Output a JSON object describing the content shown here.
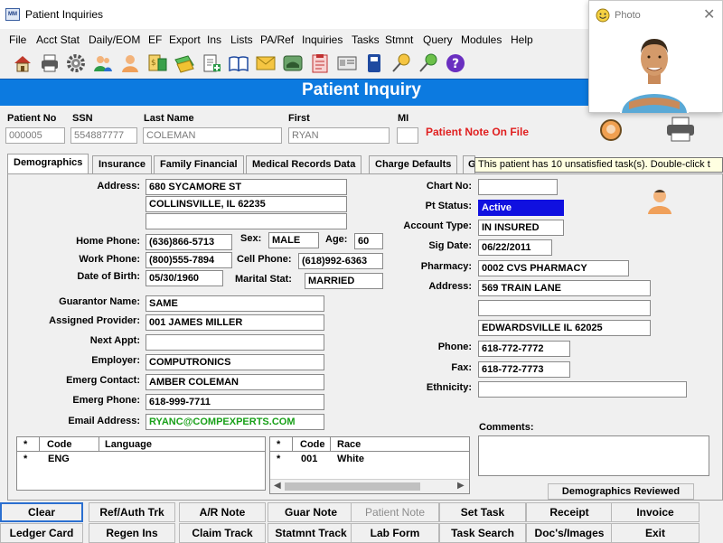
{
  "window": {
    "title": "Patient Inquiries"
  },
  "menu": [
    "File",
    "Acct Stat",
    "Daily/EOM",
    "EF",
    "Export",
    "Ins",
    "Lists",
    "PA/Ref",
    "Inquiries",
    "Tasks",
    "Stmnt",
    "Query",
    "Modules",
    "Help"
  ],
  "toolbar_icons": [
    "home-icon",
    "printer-icon",
    "gear-icon",
    "users-icon",
    "person-icon",
    "calculator-icon",
    "money-icon",
    "document-plus-icon",
    "book-icon",
    "envelope-icon",
    "car-icon",
    "clipboard-icon",
    "id-card-icon",
    "binder-icon",
    "pushpin-icon",
    "pushpin-alt-icon",
    "help-icon"
  ],
  "header": {
    "title": "Patient Inquiry"
  },
  "photo_window": {
    "title": "Photo"
  },
  "patient": {
    "labels": {
      "no": "Patient No",
      "ssn": "SSN",
      "last": "Last Name",
      "first": "First",
      "mi": "MI"
    },
    "no": "000005",
    "ssn": "554887777",
    "last": "COLEMAN",
    "first": "RYAN",
    "mi": "",
    "note_alert": "Patient Note On File"
  },
  "tabs": [
    "Demographics",
    "Insurance",
    "Family Financial",
    "Medical Records Data",
    "Charge Defaults",
    "G"
  ],
  "tooltip": "This patient has 10 unsatisfied task(s). Double-click t",
  "demo": {
    "labels": {
      "address": "Address:",
      "home_phone": "Home Phone:",
      "sex": "Sex:",
      "age": "Age:",
      "work_phone": "Work Phone:",
      "cell_phone": "Cell Phone:",
      "dob": "Date of Birth:",
      "marital": "Marital Stat:",
      "guarantor": "Guarantor Name:",
      "provider": "Assigned Provider:",
      "next_appt": "Next Appt:",
      "employer": "Employer:",
      "emerg_contact": "Emerg Contact:",
      "emerg_phone": "Emerg Phone:",
      "email": "Email Address:"
    },
    "address1": "680 SYCAMORE ST",
    "address2": "COLLINSVILLE, IL 62235",
    "address3": "",
    "home_phone": "(636)866-5713",
    "sex": "MALE",
    "age": "60",
    "work_phone": "(800)555-7894",
    "cell_phone": "(618)992-6363",
    "dob": "05/30/1960",
    "marital": "MARRIED",
    "guarantor": "SAME",
    "provider": "001 JAMES  MILLER",
    "next_appt": "",
    "employer": "COMPUTRONICS",
    "emerg_contact": "AMBER COLEMAN",
    "emerg_phone": "618-999-7711",
    "email": "RYANC@COMPEXPERTS.COM"
  },
  "right": {
    "labels": {
      "chart_no": "Chart No:",
      "pt_status": "Pt Status:",
      "account_type": "Account Type:",
      "sig_date": "Sig Date:",
      "pharmacy": "Pharmacy:",
      "address": "Address:",
      "phone": "Phone:",
      "fax": "Fax:",
      "ethnicity": "Ethnicity:",
      "comments": "Comments:"
    },
    "chart_no": "",
    "pt_status": "Active",
    "account_type": "IN INSURED",
    "sig_date": "06/22/2011",
    "pharmacy": "0002 CVS PHARMACY",
    "pharm_address1": "569 TRAIN LANE",
    "pharm_address2": "",
    "pharm_address3": "EDWARDSVILLE IL 62025",
    "phone": "618-772-7772",
    "fax": "618-772-7773",
    "ethnicity": "",
    "comments": ""
  },
  "language_grid": {
    "headers": [
      "*",
      "Code",
      "Language"
    ],
    "rows": [
      [
        "*",
        "ENG",
        ""
      ]
    ]
  },
  "race_grid": {
    "headers": [
      "*",
      "Code",
      "Race"
    ],
    "rows": [
      [
        "*",
        "001",
        "White"
      ]
    ]
  },
  "demographics_reviewed": "Demographics Reviewed",
  "buttons_row1": [
    "Clear",
    "Ref/Auth Trk",
    "A/R Note",
    "Guar Note",
    "Patient Note",
    "Set Task",
    "Receipt",
    "Invoice"
  ],
  "buttons_row2": [
    "Ledger Card",
    "Regen Ins",
    "Claim Track",
    "Statmnt Track",
    "Lab Form",
    "Task Search",
    "Doc's/Images",
    "Exit"
  ],
  "colors": {
    "header_blue": "#0c7ae0",
    "alert_red": "#e02020",
    "status_blue": "#1010e0",
    "email_green": "#19a019"
  }
}
